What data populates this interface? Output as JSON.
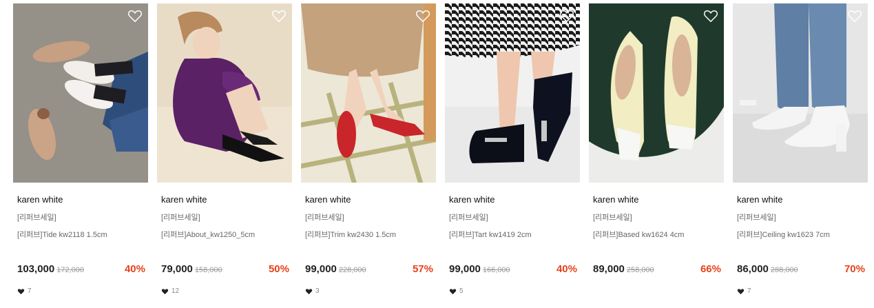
{
  "colors": {
    "discount": "#e8411c",
    "original_price": "#9a9a9a",
    "brand_text": "#111111",
    "meta_text": "#666666"
  },
  "products": [
    {
      "brand": "karen white",
      "tag": "[리퍼브세일]",
      "name": "[리퍼브]Tide kw2118 1.5cm",
      "price": "103,000",
      "original_price": "172,000",
      "discount": "40%",
      "likes": "7",
      "wish_icon": "heart-outline-icon",
      "like_icon": "heart-filled-icon"
    },
    {
      "brand": "karen white",
      "tag": "[리퍼브세일]",
      "name": "[리퍼브]About_kw1250_5cm",
      "price": "79,000",
      "original_price": "158,000",
      "discount": "50%",
      "likes": "12",
      "wish_icon": "heart-outline-icon",
      "like_icon": "heart-filled-icon"
    },
    {
      "brand": "karen white",
      "tag": "[리퍼브세일]",
      "name": "[리퍼브]Trim kw2430 1.5cm",
      "price": "99,000",
      "original_price": "228,000",
      "discount": "57%",
      "likes": "3",
      "wish_icon": "heart-outline-icon",
      "like_icon": "heart-filled-icon"
    },
    {
      "brand": "karen white",
      "tag": "[리퍼브세일]",
      "name": "[리퍼브]Tart kw1419 2cm",
      "price": "99,000",
      "original_price": "166,000",
      "discount": "40%",
      "likes": "5",
      "wish_icon": "heart-outline-icon",
      "like_icon": "heart-filled-icon"
    },
    {
      "brand": "karen white",
      "tag": "[리퍼브세일]",
      "name": "[리퍼브]Based kw1624 4cm",
      "price": "89,000",
      "original_price": "258,000",
      "discount": "66%",
      "likes": "",
      "wish_icon": "heart-outline-icon",
      "like_icon": "heart-filled-icon"
    },
    {
      "brand": "karen white",
      "tag": "[리퍼브세일]",
      "name": "[리퍼브]Ceiling kw1623 7cm",
      "price": "86,000",
      "original_price": "288,000",
      "discount": "70%",
      "likes": "7",
      "wish_icon": "heart-outline-icon",
      "like_icon": "heart-filled-icon"
    }
  ]
}
